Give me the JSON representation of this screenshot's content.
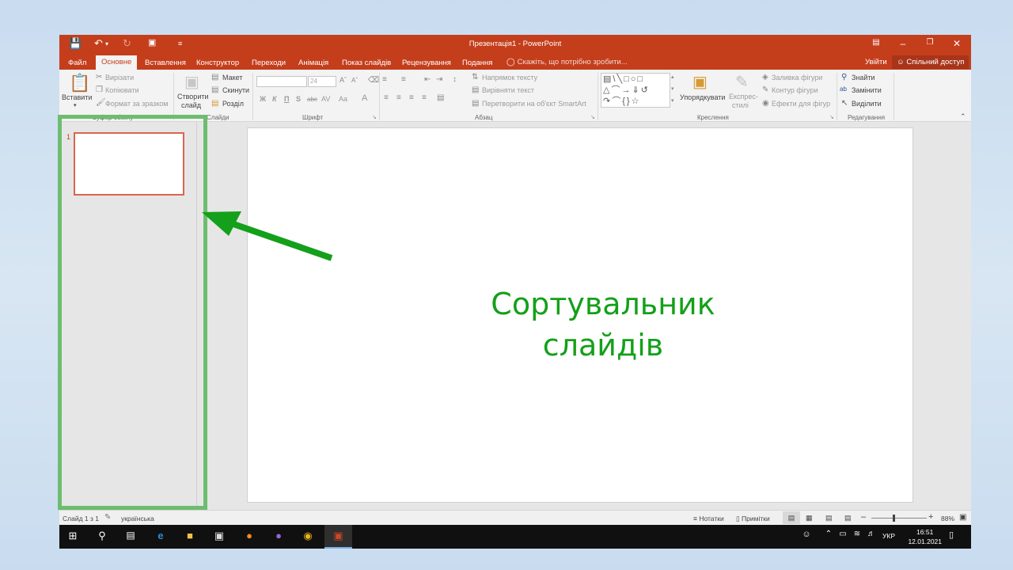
{
  "window": {
    "title": "Презентація1 - PowerPoint",
    "colors": {
      "accent": "#c43e1c",
      "annotation_green": "#14a01a",
      "highlight_green": "#6cbd6e"
    }
  },
  "tabs": [
    {
      "label": "Файл",
      "active": false
    },
    {
      "label": "Основне",
      "active": true
    },
    {
      "label": "Вставлення",
      "active": false
    },
    {
      "label": "Конструктор",
      "active": false
    },
    {
      "label": "Переходи",
      "active": false
    },
    {
      "label": "Анімація",
      "active": false
    },
    {
      "label": "Показ слайдів",
      "active": false
    },
    {
      "label": "Рецензування",
      "active": false
    },
    {
      "label": "Подання",
      "active": false
    }
  ],
  "tellme": "Скажіть, що потрібно зробити...",
  "signin": "Увійти",
  "share": "Спільний доступ",
  "ribbon": {
    "clipboard": {
      "paste": "Вставити",
      "cut": "Вирізати",
      "copy": "Копіювати",
      "format_painter": "Формат за зразком",
      "group": "Буфер обміну"
    },
    "slides": {
      "new_slide_1": "Створити",
      "new_slide_2": "слайд",
      "layout": "Макет",
      "reset": "Скинути",
      "section": "Розділ",
      "group": "Слайди"
    },
    "font": {
      "size": "24",
      "group": "Шрифт",
      "bold": "Ж",
      "italic": "К",
      "underline": "П",
      "shadow": "S",
      "strike": "abc",
      "spacing": "AV",
      "case": "Aa",
      "color": "A"
    },
    "paragraph": {
      "text_direction": "Напрямок тексту",
      "align_text": "Вирівняти текст",
      "smartart": "Перетворити на об'єкт SmartArt",
      "group": "Абзац"
    },
    "drawing": {
      "arrange": "Упорядкувати",
      "quick_styles_1": "Експрес-",
      "quick_styles_2": "стилі",
      "fill": "Заливка фігури",
      "outline": "Контур фігури",
      "effects": "Ефекти для фігур",
      "group": "Креслення"
    },
    "editing": {
      "find": "Знайти",
      "replace": "Замінити",
      "select": "Виділити",
      "group": "Редагування"
    }
  },
  "thumbnail": {
    "number": "1"
  },
  "status": {
    "slide": "Слайд 1 з 1",
    "language": "українська",
    "notes": "Нотатки",
    "comments": "Примітки",
    "zoom": "88%"
  },
  "taskbar": {
    "language": "УКР",
    "time": "16:51",
    "date": "12.01.2021"
  },
  "annotation": {
    "line1": "Сортувальник",
    "line2": "слайдів"
  }
}
